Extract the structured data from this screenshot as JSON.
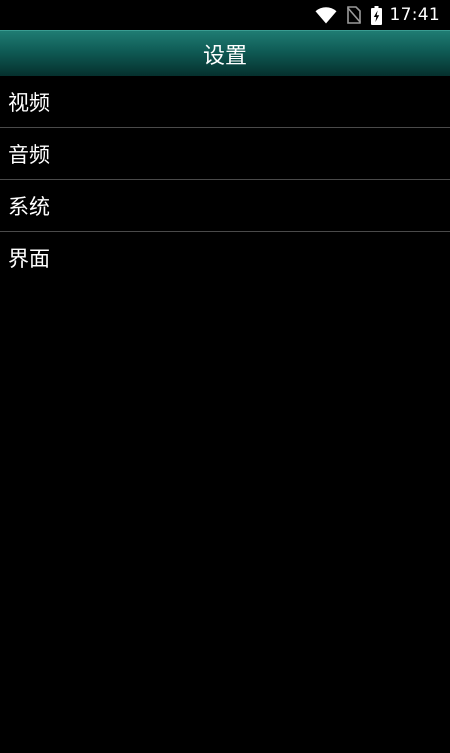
{
  "status_bar": {
    "time": "17:41",
    "icons": [
      "wifi-icon",
      "no-sim-icon",
      "battery-charging-icon"
    ]
  },
  "header": {
    "title": "设置"
  },
  "menu": {
    "items": [
      {
        "label": "视频"
      },
      {
        "label": "音频"
      },
      {
        "label": "系统"
      },
      {
        "label": "界面"
      }
    ]
  },
  "colors": {
    "background": "#000000",
    "title_bar_top": "#1f7c73",
    "title_bar_bottom": "#05302d",
    "divider": "#4a4a4a",
    "text": "#ffffff"
  }
}
